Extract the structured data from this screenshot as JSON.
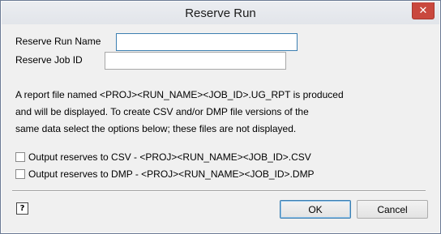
{
  "window": {
    "title": "Reserve Run",
    "close_glyph": "✕"
  },
  "form": {
    "run_name_label": "Reserve Run Name",
    "run_name_value": "",
    "job_id_label": "Reserve Job ID",
    "job_id_value": ""
  },
  "info": {
    "line1": "A report file named <PROJ><RUN_NAME><JOB_ID>.UG_RPT is produced",
    "line2": "and will be displayed.  To create CSV and/or DMP file versions of the",
    "line3": "same data select the options below; these files are not displayed."
  },
  "options": [
    {
      "label": "Output reserves to CSV - <PROJ><RUN_NAME><JOB_ID>.CSV",
      "checked": false
    },
    {
      "label": "Output reserves to DMP - <PROJ><RUN_NAME><JOB_ID>.DMP",
      "checked": false
    }
  ],
  "footer": {
    "help_icon": "help-icon",
    "help_glyph": "?",
    "ok_label": "OK",
    "cancel_label": "Cancel"
  }
}
